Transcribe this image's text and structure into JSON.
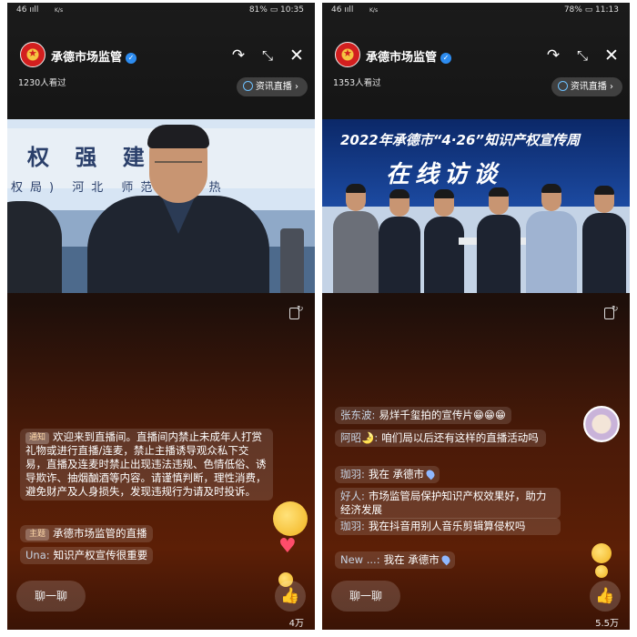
{
  "left": {
    "status": {
      "signal": "46 ııll",
      "net": "K/s",
      "battery_time": "81% ▭ 10:35"
    },
    "account_name": "承德市场监管",
    "viewers": "1230人看过",
    "news_pill": "资讯直播 ›",
    "banner_text": "权 强  建 设",
    "banner_sub": "权局)  河北    师范学院 热",
    "notice_tag": "通知",
    "notice_text": "欢迎来到直播间。直播间内禁止未成年人打赏礼物或进行直播/连麦，禁止主播诱导观众私下交易，直播及连麦时禁止出现违法违规、色情低俗、诱导欺诈、抽烟酗酒等内容。请谨慎判断，理性消费，避免财产及人身损失，发现违规行为请及时投诉。",
    "topic_tag": "主题",
    "topic_text": "承德市场监管的直播",
    "comment_user": "Una:",
    "comment_text": "知识产权宣传很重要",
    "chat_button": "聊一聊",
    "like_count": "4万"
  },
  "right": {
    "status": {
      "signal": "46 ııll",
      "net": "K/s",
      "battery_time": "78% ▭ 11:13"
    },
    "account_name": "承德市场监管",
    "viewers": "1353人看过",
    "news_pill": "资讯直播 ›",
    "banner_title": "2022年承德市“4·26”知识产权宣传周",
    "banner_main": "在线访谈",
    "comments": [
      {
        "user": "张东波:",
        "text": "易烊千玺拍的宣传片😁😁😁",
        "loc": ""
      },
      {
        "user": "阿昭🌛:",
        "text": "咱们局以后还有这样的直播活动吗",
        "loc": ""
      },
      {
        "user": "珈羽:",
        "text": "我在 承德市",
        "loc": "pin"
      },
      {
        "user": "好人:",
        "text": "市场监管局保护知识产权效果好，助力经济发展",
        "loc": ""
      },
      {
        "user": "珈羽:",
        "text": "我在抖音用别人音乐剪辑算侵权吗",
        "loc": ""
      },
      {
        "user": "New ...:",
        "text": "我在 承德市",
        "loc": "pin"
      }
    ],
    "chat_button": "聊一聊",
    "like_count": "5.5万"
  },
  "icons": {
    "share": "share-icon",
    "shrink": "shrink-icon",
    "close": "close-icon",
    "like": "thumbs-up-icon",
    "rotate": "rotate-screen-icon",
    "globe": "globe-icon"
  },
  "colors": {
    "verify_badge": "#2d8cf0",
    "tag_text": "#ffd8a8",
    "user_name": "#c7d4e4"
  }
}
